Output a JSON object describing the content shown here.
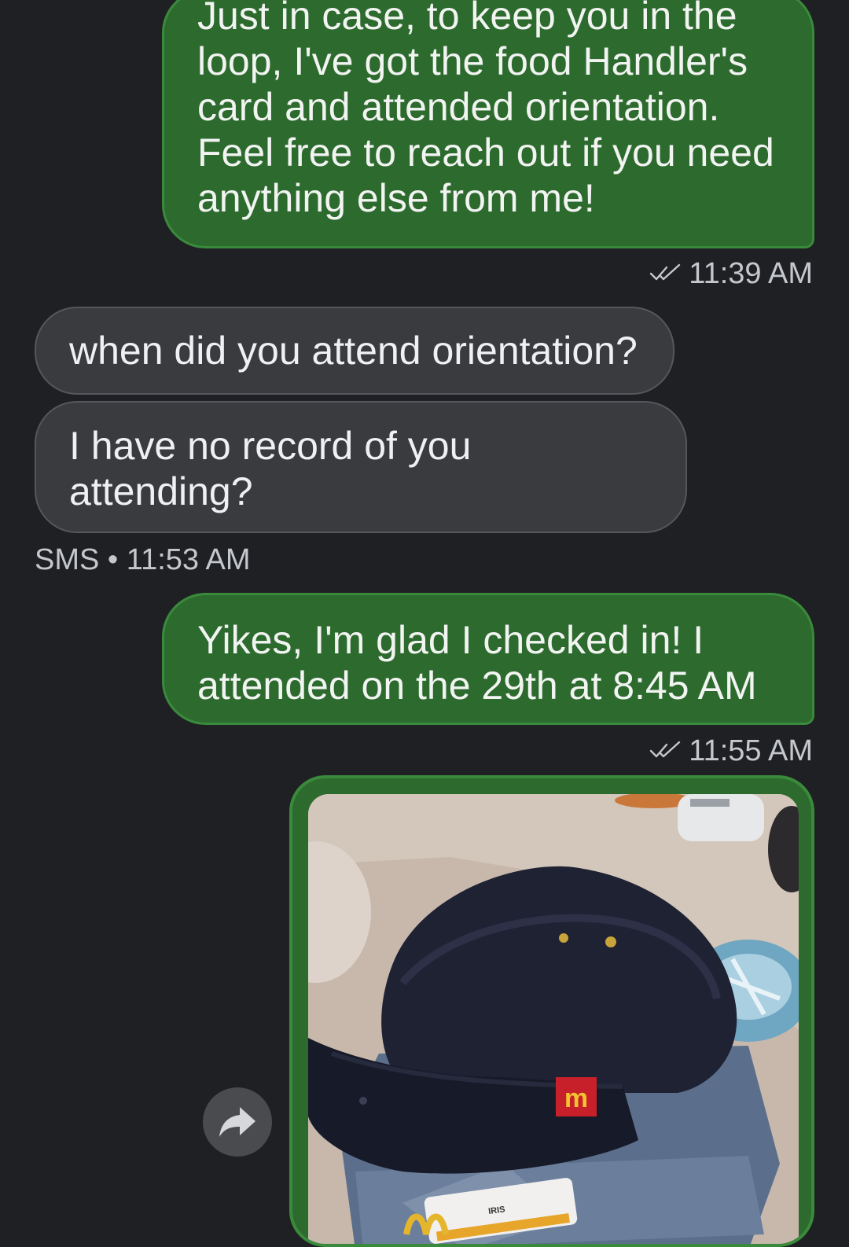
{
  "messages": [
    {
      "lines": [
        "Just in case, to keep you in the",
        "loop, I've got the food Handler's",
        "card and attended orientation.",
        "Feel free to reach out if you need",
        "anything else from me!"
      ]
    },
    {
      "text": "when did you attend orientation?"
    },
    {
      "lines": [
        "I have no record of you",
        "attending?"
      ]
    },
    {
      "lines": [
        "Yikes, I'm glad I checked in! I",
        "attended on the 29th at 8:45 AM"
      ]
    }
  ],
  "meta": {
    "sent_1_time": "11:39 AM",
    "received_label": "SMS • 11:53 AM",
    "sent_2_time": "11:55 AM"
  },
  "photo": {
    "badge_text": "IRIS",
    "logo_text": "m"
  },
  "icons": {
    "read_receipt": "double-check-icon",
    "share": "forward-arrow-icon"
  },
  "colors": {
    "background": "#1f2023",
    "outgoing_bubble": "#2d6a2e",
    "incoming_bubble": "#3a3b3f",
    "meta_text": "#c4c7cb"
  }
}
